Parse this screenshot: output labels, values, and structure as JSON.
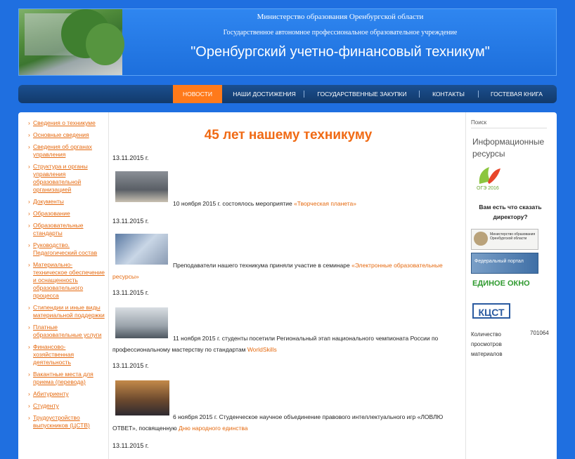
{
  "header": {
    "line1": "Министерство образования Оренбургской области",
    "line2": "Государственное автономное профессиональное образовательное учреждение",
    "title": "\"Оренбургский учетно-финансовый техникум\""
  },
  "nav": {
    "items": [
      {
        "label": "НОВОСТИ",
        "active": true
      },
      {
        "label": "НАШИ ДОСТИЖЕНИЯ",
        "active": false
      },
      {
        "label": "ГОСУДАРСТВЕННЫЕ ЗАКУПКИ",
        "active": false
      },
      {
        "label": "КОНТАКТЫ",
        "active": false
      },
      {
        "label": "ГОСТЕВАЯ КНИГА",
        "active": false
      }
    ]
  },
  "sidebar": {
    "items": [
      "Сведения о техникуме",
      "Основные сведения",
      "Сведения об органах управления",
      "Структура и органы управления образовательной организацией",
      "Документы",
      "Образование",
      "Образовательные стандарты",
      "Руководство. Педагогический состав",
      "Материально-техническое обеспечение и оснащенность образовательного процесса",
      "Стипендии и иные виды материальной поддержки",
      "Платные образовательные услуги",
      "Финансово-хозяйственная деятельность",
      "Вакантные места для приема (перевода)",
      "Абитуриенту",
      "Студенту",
      "Трудоустройство выпускников (ЦСТВ)"
    ]
  },
  "main": {
    "title": "45 лет нашему техникуму",
    "news": [
      {
        "date": "13.11.2015 г.",
        "text": "10 ноября 2015 г. состоялось мероприятие ",
        "link": "«Творческая планета»",
        "text2": ""
      },
      {
        "date": "13.11.2015 г.",
        "text": "Преподаватели нашего техникума приняли участие в семинаре ",
        "link": "«Электронные образовательные ресурсы»",
        "text2": ""
      },
      {
        "date": "13.11.2015 г.",
        "text": "11 ноября 2015 г. студенты посетили Региональный этап национального чемпионата России по профессиональному мастерству по стандартам ",
        "link": "WorldSkills",
        "text2": ""
      },
      {
        "date": "13.11.2015 г.",
        "text": "6 ноября 2015 г. Студенческое научное объединение правового интеллектуального игр «ЛОВЛЮ ОТВЕТ», посвященную ",
        "link": "Дню народного единства",
        "text2": ""
      },
      {
        "date": "13.11.2015 г.",
        "text": "",
        "link": "",
        "text2": ""
      }
    ]
  },
  "right": {
    "search_label": "Поиск",
    "info_resources": "Информационные ресурсы",
    "logo1_text": "ОГЭ 2016",
    "ask_director": "Вам есть что сказать директору?",
    "banner1_text": "Министерство образования Оренбургской области",
    "banner2_text": "Федеральный портал",
    "banner3_text": "ЕДИНОЕ ОКНО",
    "banner4_text": "КЦСТ",
    "views_label": "Количество просмотров материалов",
    "views_count": "701064"
  },
  "colors": {
    "background": "#1f6fe0",
    "accent": "#ff7a1a",
    "link": "#e56a10",
    "nav": "#123a6b"
  }
}
